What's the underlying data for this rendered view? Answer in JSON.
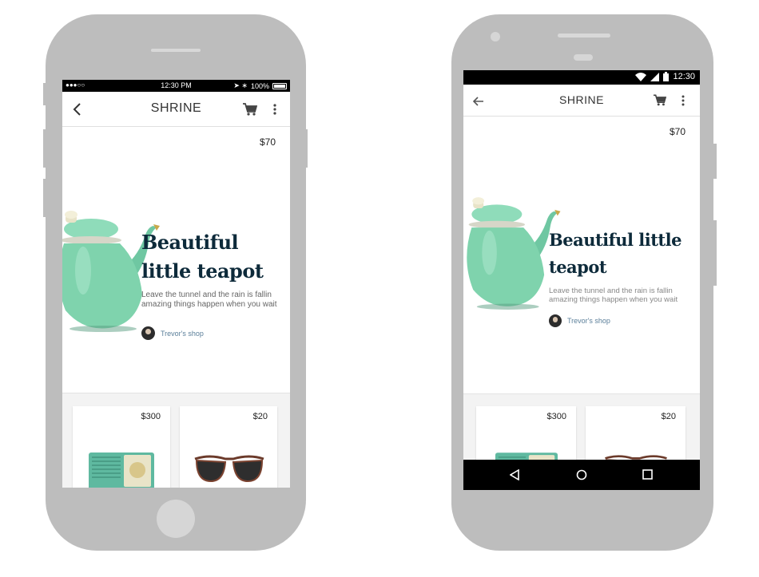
{
  "ios": {
    "status": {
      "carrier": "●●●○○",
      "time": "12:30 PM",
      "battery": "100%"
    },
    "appbar": {
      "title": "SHRINE"
    },
    "hero": {
      "price": "$70",
      "title_line1": "Beautiful",
      "title_line2": "little teapot",
      "description": "Leave the tunnel and the rain is fallin amazing things happen when you wait",
      "shop": "Trevor's shop"
    },
    "cards": [
      {
        "price": "$300"
      },
      {
        "price": "$20"
      }
    ]
  },
  "android": {
    "status": {
      "time": "12:30"
    },
    "appbar": {
      "title": "SHRINE"
    },
    "hero": {
      "price": "$70",
      "title_line1": "Beautiful little",
      "title_line2": "teapot",
      "description": "Leave the tunnel and the rain is fallin amazing things happen when you wait",
      "shop": "Trevor's shop"
    },
    "cards": [
      {
        "price": "$300"
      },
      {
        "price": "$20"
      }
    ]
  },
  "colors": {
    "phone_body": "#bdbdbd",
    "headline": "#0d2a3a",
    "teapot": "#7fd3ad",
    "radio": "#5fb9a0",
    "shop_link": "#5b7f9a"
  },
  "icons": [
    "back-chevron-icon",
    "back-arrow-icon",
    "cart-icon",
    "more-vert-icon",
    "wifi-icon",
    "cell-signal-icon",
    "battery-icon",
    "nav-back-icon",
    "nav-home-icon",
    "nav-recents-icon"
  ]
}
